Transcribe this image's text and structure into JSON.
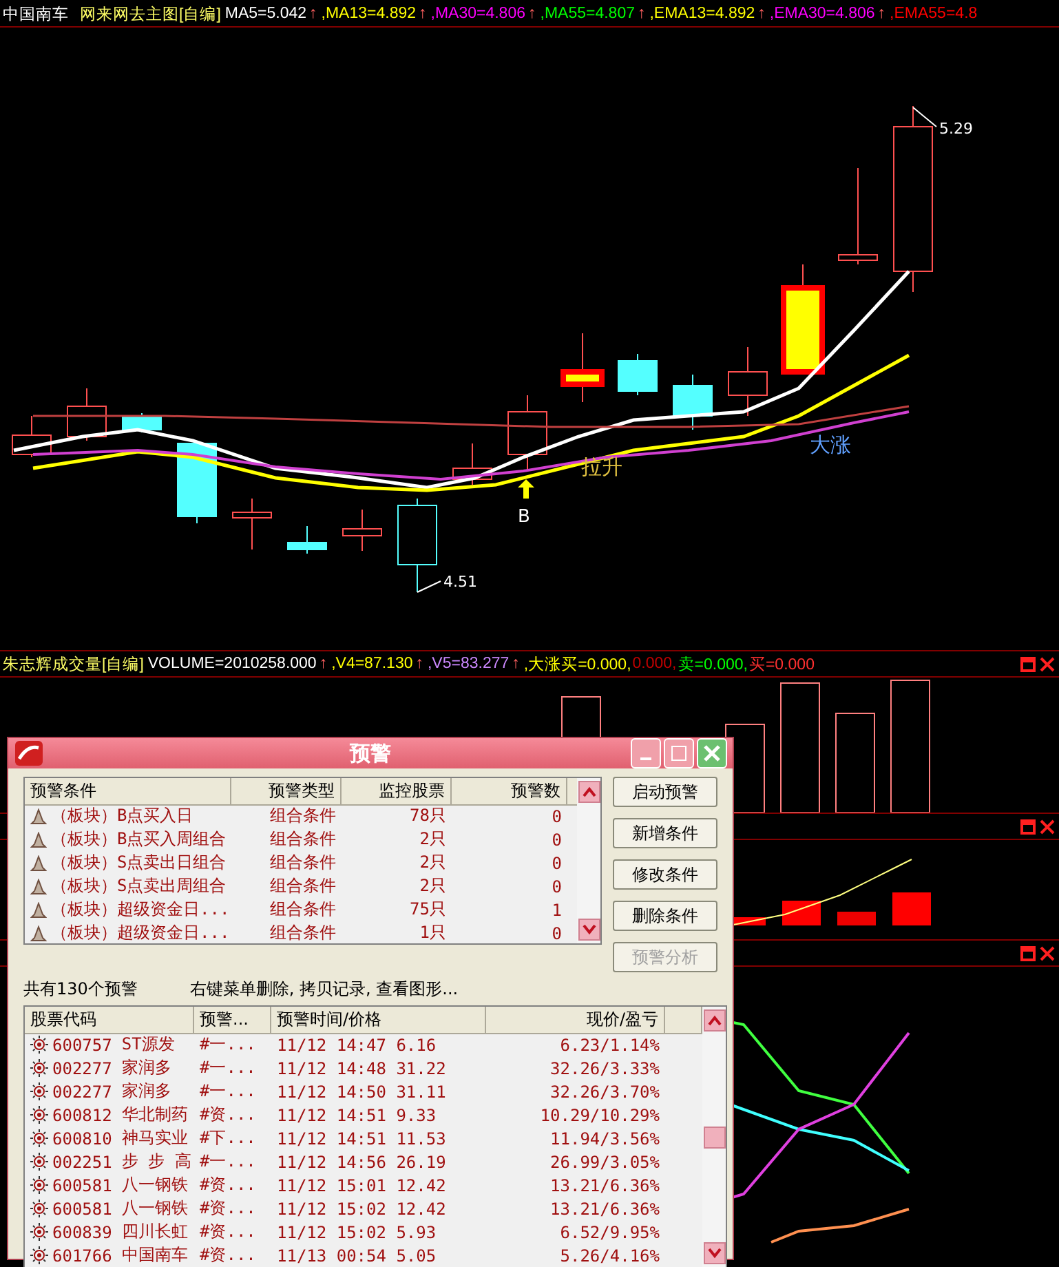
{
  "main_header": {
    "stock": "中国南车",
    "formula": "网来网去主图[自编]",
    "indicators": [
      {
        "text": "MA5=5.042",
        "arrow": "↑",
        "color": "#ffffff"
      },
      {
        "text": ",MA13=4.892",
        "arrow": "↑",
        "color": "#ffff00"
      },
      {
        "text": ",MA30=4.806",
        "arrow": "↑",
        "color": "#ff00ff"
      },
      {
        "text": ",MA55=4.807",
        "arrow": "↑",
        "color": "#00ff00"
      },
      {
        "text": ",EMA13=4.892",
        "arrow": "↑",
        "color": "#ffff00"
      },
      {
        "text": ",EMA30=4.806",
        "arrow": "↑",
        "color": "#ff00ff"
      },
      {
        "text": ",EMA55=4.8",
        "color": "#ff0000"
      }
    ]
  },
  "main_chart": {
    "labels": [
      "5.29",
      "4.51",
      "B",
      "拉升",
      "大涨"
    ]
  },
  "volume_header": {
    "formula": "朱志辉成交量[自编]",
    "indicators": [
      {
        "text": "VOLUME=2010258.000",
        "arrow": "↑",
        "color": "#ffffff"
      },
      {
        "text": ",V4=87.130",
        "arrow": "↑",
        "color": "#ffff00"
      },
      {
        "text": ",V5=83.277",
        "arrow": "↑",
        "color": "#cc88ff"
      },
      {
        "text": ",大涨买=0.000,",
        "color": "#ffff00"
      },
      {
        "text": "0.000,",
        "color": "#c00000"
      },
      {
        "text": "卖=0.000,",
        "color": "#00ff00"
      },
      {
        "text": "买=0.000",
        "color": "#ff3030"
      }
    ]
  },
  "alert_dialog": {
    "title": "预警",
    "conditions": {
      "columns": [
        "预警条件",
        "预警类型",
        "监控股票",
        "预警数"
      ],
      "rows": [
        {
          "name": "（板块）B点买入日",
          "type": "组合条件",
          "stocks": "78只",
          "count": "0"
        },
        {
          "name": "（板块）B点买入周组合",
          "type": "组合条件",
          "stocks": "2只",
          "count": "0"
        },
        {
          "name": "（板块）S点卖出日组合",
          "type": "组合条件",
          "stocks": "2只",
          "count": "0"
        },
        {
          "name": "（板块）S点卖出周组合",
          "type": "组合条件",
          "stocks": "2只",
          "count": "0"
        },
        {
          "name": "（板块）超级资金日...",
          "type": "组合条件",
          "stocks": "75只",
          "count": "1"
        },
        {
          "name": "（板块）超级资金日...",
          "type": "组合条件",
          "stocks": "1只",
          "count": "0"
        }
      ]
    },
    "buttons": [
      {
        "label": "启动预警",
        "disabled": false
      },
      {
        "label": "新增条件",
        "disabled": false
      },
      {
        "label": "修改条件",
        "disabled": false
      },
      {
        "label": "删除条件",
        "disabled": false
      },
      {
        "label": "预警分析",
        "disabled": true
      }
    ],
    "summary": "共有130个预警",
    "hint": "右键菜单删除, 拷贝记录, 查看图形...",
    "alerts": {
      "columns": [
        "股票代码",
        "预警...",
        "预警时间/价格",
        "现价/盈亏"
      ],
      "rows": [
        {
          "code": "600757",
          "name": "ST源发",
          "alert": "#一...",
          "time_price": "11/12 14:47 6.16",
          "price_pnl": "6.23/1.14%"
        },
        {
          "code": "002277",
          "name": "家润多",
          "alert": "#一...",
          "time_price": "11/12 14:48 31.22",
          "price_pnl": "32.26/3.33%"
        },
        {
          "code": "002277",
          "name": "家润多",
          "alert": "#一...",
          "time_price": "11/12 14:50 31.11",
          "price_pnl": "32.26/3.70%"
        },
        {
          "code": "600812",
          "name": "华北制药",
          "alert": "#资...",
          "time_price": "11/12 14:51 9.33",
          "price_pnl": "10.29/10.29%"
        },
        {
          "code": "600810",
          "name": "神马实业",
          "alert": "#下...",
          "time_price": "11/12 14:51 11.53",
          "price_pnl": "11.94/3.56%"
        },
        {
          "code": "002251",
          "name": "步 步 高",
          "alert": "#一...",
          "time_price": "11/12 14:56 26.19",
          "price_pnl": "26.99/3.05%"
        },
        {
          "code": "600581",
          "name": "八一钢铁",
          "alert": "#资...",
          "time_price": "11/12 15:01 12.42",
          "price_pnl": "13.21/6.36%"
        },
        {
          "code": "600581",
          "name": "八一钢铁",
          "alert": "#资...",
          "time_price": "11/12 15:02 12.42",
          "price_pnl": "13.21/6.36%"
        },
        {
          "code": "600839",
          "name": "四川长虹",
          "alert": "#资...",
          "time_price": "11/12 15:02 5.93",
          "price_pnl": "6.52/9.95%"
        },
        {
          "code": "601766",
          "name": "中国南车",
          "alert": "#资...",
          "time_price": "11/13 00:54 5.05",
          "price_pnl": "5.26/4.16%"
        }
      ]
    }
  }
}
